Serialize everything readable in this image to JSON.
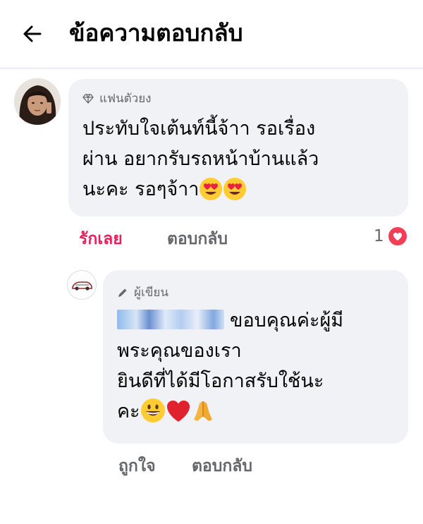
{
  "header": {
    "title": "ข้อความตอบกลับ",
    "back_icon": "arrow-left-icon"
  },
  "comment": {
    "badge": "แฟนตัวยง",
    "badge_icon": "diamond-icon",
    "text_lines": [
      "ประทับใจเต้นท์นี้จ้าา รอเรื่อง",
      "ผ่าน อยากรับรถหน้าบ้านแล้ว",
      "นะคะ รอๆจ้าา"
    ],
    "emojis": [
      "heart-eyes-emoji",
      "heart-eyes-emoji"
    ],
    "actions": {
      "love": "รักเลย",
      "reply": "ตอบกลับ"
    },
    "reaction_count": "1",
    "reaction_icon": "heart-icon",
    "love_color": "#e0245e"
  },
  "reply": {
    "badge": "ผู้เขียน",
    "badge_icon": "pencil-icon",
    "text_line1_after_name": "ขอบคุณค่ะผู้มี",
    "text_line2": "พระคุณของเรา",
    "text_line3": "ยินดีที่ได้มีโอกาสรับใช้นะ",
    "text_line4": "คะ",
    "emojis": [
      "grinning-face-emoji",
      "red-heart-emoji",
      "folded-hands-emoji"
    ],
    "actions": {
      "like": "ถูกใจ",
      "reply": "ตอบกลับ"
    }
  }
}
